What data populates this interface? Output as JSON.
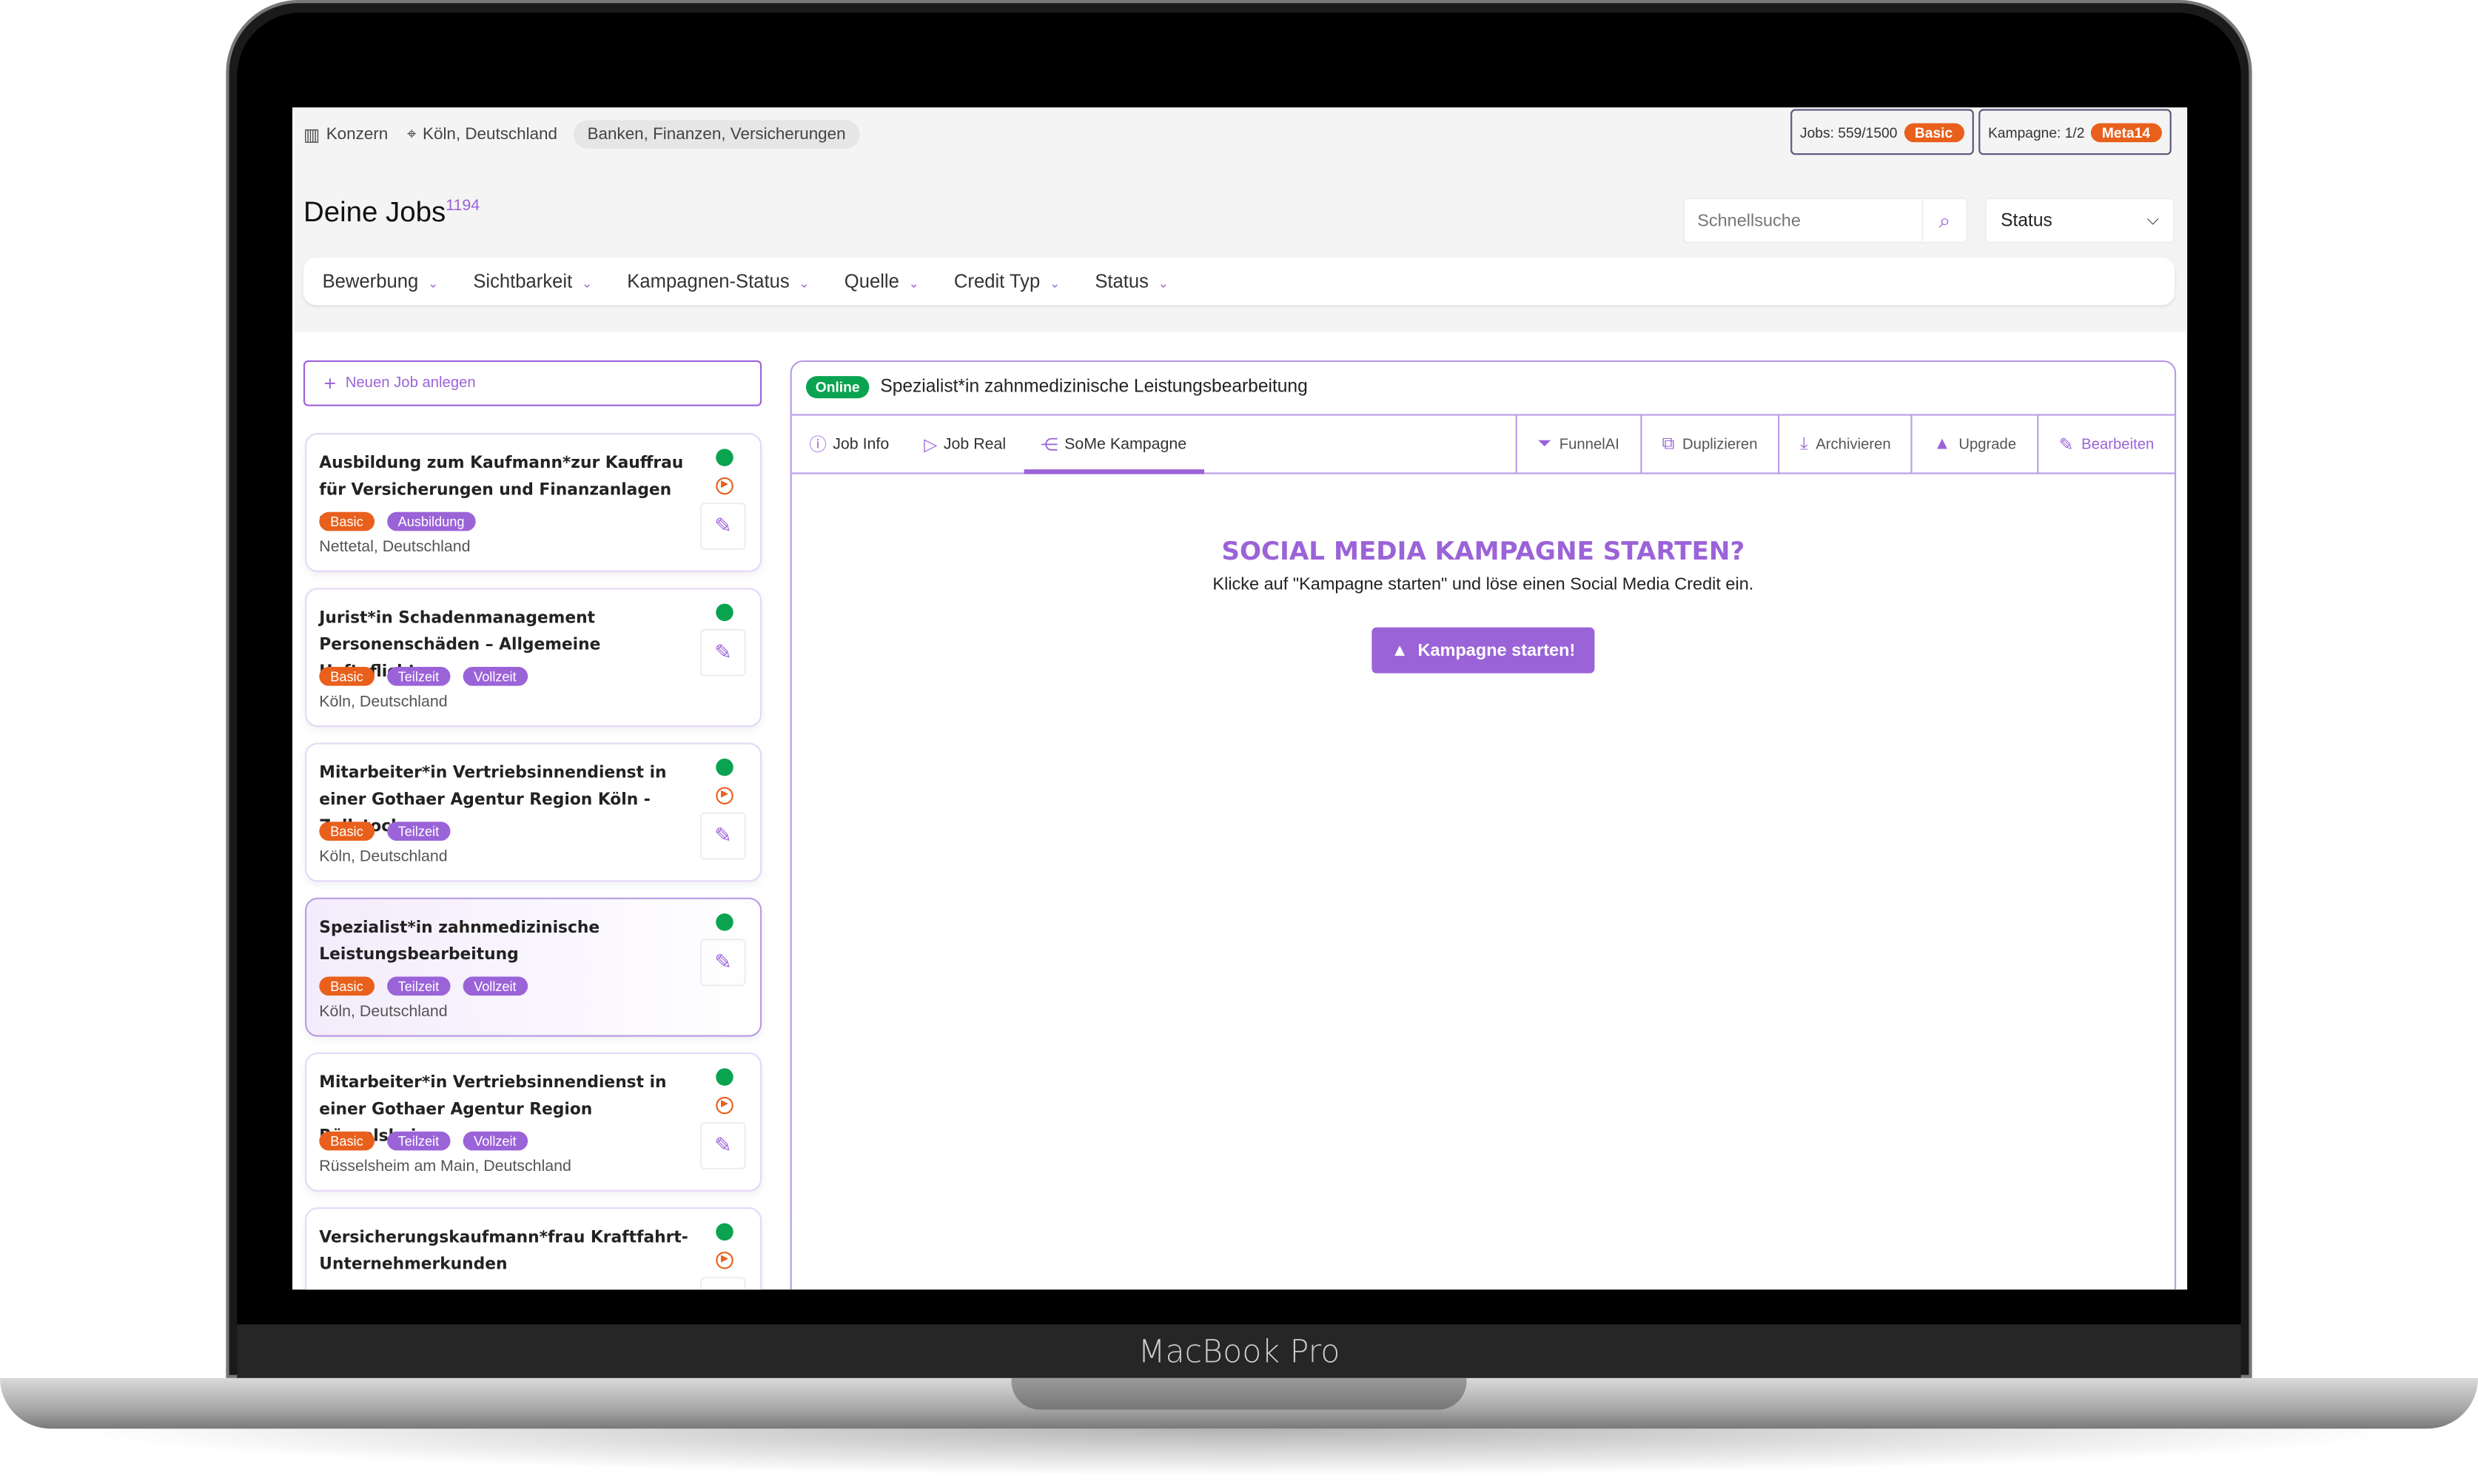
{
  "device": {
    "label": "MacBook Pro"
  },
  "company": {
    "type": "Konzern",
    "location": "Köln, Deutschland",
    "industry": "Banken, Finanzen, Versicherungen"
  },
  "quotas": {
    "jobs_label": "Jobs: 559/1500",
    "jobs_badge": "Basic",
    "campaign_label": "Kampagne: 1/2",
    "campaign_badge": "Meta14"
  },
  "header": {
    "title": "Deine Jobs",
    "count": "1194",
    "search_placeholder": "Schnellsuche",
    "status_select": "Status"
  },
  "filters": [
    "Bewerbung",
    "Sichtbarkeit",
    "Kampagnen-Status",
    "Quelle",
    "Credit Typ",
    "Status"
  ],
  "new_job_label": "Neuen Job anlegen",
  "jobs": [
    {
      "title": "Ausbildung zum Kaufmann*zur Kauffrau für Versicherungen und Finanzanlagen –...",
      "tags": [
        "Basic",
        "Ausbildung"
      ],
      "location": "Nettetal, Deutschland",
      "video": true
    },
    {
      "title": "Jurist*in Schadenmanagement Personenschäden – Allgemeine Haftpflicht",
      "tags": [
        "Basic",
        "Teilzeit",
        "Vollzeit"
      ],
      "location": "Köln, Deutschland",
      "video": false
    },
    {
      "title": "Mitarbeiter*in Vertriebsinnendienst in einer Gothaer Agentur Region Köln - Zollstock",
      "tags": [
        "Basic",
        "Teilzeit"
      ],
      "location": "Köln, Deutschland",
      "video": true
    },
    {
      "title": "Spezialist*in zahnmedizinische Leistungsbearbeitung",
      "tags": [
        "Basic",
        "Teilzeit",
        "Vollzeit"
      ],
      "location": "Köln, Deutschland",
      "video": false,
      "selected": true
    },
    {
      "title": "Mitarbeiter*in Vertriebsinnendienst in einer Gothaer Agentur Region Rüsselsheim",
      "tags": [
        "Basic",
        "Teilzeit",
        "Vollzeit"
      ],
      "location": "Rüsselsheim am Main, Deutschland",
      "video": true
    },
    {
      "title": "Versicherungskaufmann*frau Kraftfahrt-Unternehmerkunden",
      "tags": [],
      "location": "",
      "video": true
    }
  ],
  "detail": {
    "status": "Online",
    "title": "Spezialist*in zahnmedizinische Leistungsbearbeitung",
    "tabs": [
      "Job Info",
      "Job Real",
      "SoMe Kampagne"
    ],
    "active_tab": "SoMe Kampagne",
    "actions": [
      "FunnelAI",
      "Duplizieren",
      "Archivieren",
      "Upgrade",
      "Bearbeiten"
    ],
    "campaign": {
      "heading": "SOCIAL MEDIA KAMPAGNE STARTEN?",
      "text": "Klicke auf \"Kampagne starten\" und löse einen Social Media Credit ein.",
      "button": "Kampagne starten!"
    }
  },
  "colors": {
    "accent": "#9b63d8",
    "orange": "#e8601c",
    "online": "#0aa350"
  }
}
